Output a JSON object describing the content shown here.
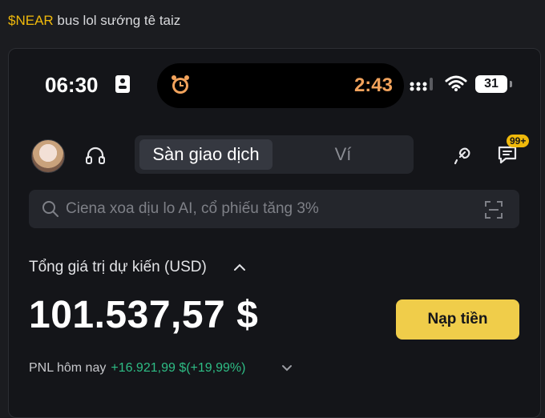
{
  "post": {
    "ticker": "$NEAR",
    "text": " bus lol sướng tê taiz"
  },
  "status_bar": {
    "time": "06:30",
    "timer": "2:43",
    "battery": "31"
  },
  "header": {
    "tabs": [
      "Sàn giao dịch",
      "Ví"
    ],
    "active_tab": "Sàn giao dịch",
    "chat_badge": "99+"
  },
  "search": {
    "placeholder": "Ciena xoa dịu lo AI, cổ phiếu tăng 3%"
  },
  "portfolio": {
    "estimated_label": "Tổng giá trị dự kiến (USD)",
    "balance": "101.537,57 $",
    "deposit_label": "Nạp tiền",
    "pnl_label": "PNL hôm nay",
    "pnl_value": "+16.921,99 $(+19,99%)"
  },
  "colors": {
    "accent": "#f0b90b",
    "button": "#f0cd4a",
    "positive": "#2ebd85",
    "timer": "#f2a35c",
    "background": "#141519"
  },
  "icons": [
    "alarm-icon",
    "signal-icon",
    "wifi-icon",
    "headset-icon",
    "link-icon",
    "chat-icon",
    "search-icon",
    "scan-icon",
    "chevron-up-icon",
    "chevron-down-icon"
  ]
}
